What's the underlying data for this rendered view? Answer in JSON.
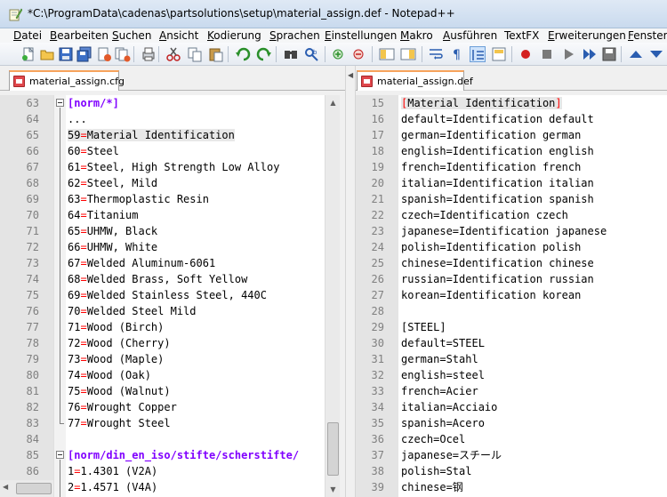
{
  "window": {
    "title": "*C:\\ProgramData\\cadenas\\partsolutions\\setup\\material_assign.def - Notepad++"
  },
  "menu": [
    {
      "label": "Datei",
      "u": "D",
      "rest": "atei"
    },
    {
      "label": "Bearbeiten",
      "u": "B",
      "rest": "earbeiten"
    },
    {
      "label": "Suchen",
      "u": "S",
      "rest": "uchen"
    },
    {
      "label": "Ansicht",
      "u": "A",
      "rest": "nsicht"
    },
    {
      "label": "Kodierung",
      "u": "K",
      "rest": "odierung"
    },
    {
      "label": "Sprachen",
      "u": "S",
      "rest": "prachen"
    },
    {
      "label": "Einstellungen",
      "u": "E",
      "rest": "instellungen"
    },
    {
      "label": "Makro",
      "u": "M",
      "rest": "akro"
    },
    {
      "label": "Ausführen",
      "u": "A",
      "rest": "usführen"
    },
    {
      "label": "TextFX",
      "u": "",
      "rest": "TextFX"
    },
    {
      "label": "Erweiterungen",
      "u": "E",
      "rest": "rweiterungen"
    },
    {
      "label": "Fenster",
      "u": "F",
      "rest": "enster"
    }
  ],
  "toolbar": [
    {
      "name": "new-file-icon"
    },
    {
      "name": "open-file-icon"
    },
    {
      "name": "save-icon"
    },
    {
      "name": "save-all-icon"
    },
    {
      "name": "close-icon"
    },
    {
      "name": "close-all-icon"
    },
    {
      "name": "print-icon"
    },
    {
      "name": "cut-icon"
    },
    {
      "name": "copy-icon"
    },
    {
      "name": "paste-icon"
    },
    {
      "name": "undo-icon"
    },
    {
      "name": "redo-icon"
    },
    {
      "name": "find-icon"
    },
    {
      "name": "replace-icon"
    },
    {
      "name": "zoom-in-icon"
    },
    {
      "name": "zoom-out-icon"
    },
    {
      "name": "sync-vertical-icon"
    },
    {
      "name": "sync-horizontal-icon"
    },
    {
      "name": "word-wrap-icon"
    },
    {
      "name": "show-all-chars-icon"
    },
    {
      "name": "indent-guide-icon"
    },
    {
      "name": "doc-map-icon"
    },
    {
      "name": "record-macro-icon"
    },
    {
      "name": "stop-macro-icon"
    },
    {
      "name": "play-macro-icon"
    },
    {
      "name": "run-macro-multiple-icon"
    },
    {
      "name": "save-macro-icon"
    },
    {
      "name": "upload-icon"
    },
    {
      "name": "download-icon"
    }
  ],
  "left": {
    "tab": "material_assign.cfg",
    "lines": [
      {
        "n": "63",
        "parts": [
          {
            "t": "[norm/*]",
            "c": "section"
          }
        ],
        "fold": "start"
      },
      {
        "n": "64",
        "parts": [
          {
            "t": "...",
            "c": "key"
          }
        ]
      },
      {
        "n": "65",
        "parts": [
          {
            "t": "59",
            "c": "key"
          },
          {
            "t": "=",
            "c": "eq"
          },
          {
            "t": "Material Identification",
            "c": "key"
          }
        ],
        "hl": true
      },
      {
        "n": "66",
        "parts": [
          {
            "t": "60",
            "c": "key"
          },
          {
            "t": "=",
            "c": "eq"
          },
          {
            "t": "Steel",
            "c": "key"
          }
        ]
      },
      {
        "n": "67",
        "parts": [
          {
            "t": "61",
            "c": "key"
          },
          {
            "t": "=",
            "c": "eq"
          },
          {
            "t": "Steel, High Strength Low Alloy",
            "c": "key"
          }
        ]
      },
      {
        "n": "68",
        "parts": [
          {
            "t": "62",
            "c": "key"
          },
          {
            "t": "=",
            "c": "eq"
          },
          {
            "t": "Steel, Mild",
            "c": "key"
          }
        ]
      },
      {
        "n": "69",
        "parts": [
          {
            "t": "63",
            "c": "key"
          },
          {
            "t": "=",
            "c": "eq"
          },
          {
            "t": "Thermoplastic Resin",
            "c": "key"
          }
        ]
      },
      {
        "n": "70",
        "parts": [
          {
            "t": "64",
            "c": "key"
          },
          {
            "t": "=",
            "c": "eq"
          },
          {
            "t": "Titanium",
            "c": "key"
          }
        ]
      },
      {
        "n": "71",
        "parts": [
          {
            "t": "65",
            "c": "key"
          },
          {
            "t": "=",
            "c": "eq"
          },
          {
            "t": "UHMW, Black",
            "c": "key"
          }
        ]
      },
      {
        "n": "72",
        "parts": [
          {
            "t": "66",
            "c": "key"
          },
          {
            "t": "=",
            "c": "eq"
          },
          {
            "t": "UHMW, White",
            "c": "key"
          }
        ]
      },
      {
        "n": "73",
        "parts": [
          {
            "t": "67",
            "c": "key"
          },
          {
            "t": "=",
            "c": "eq"
          },
          {
            "t": "Welded Aluminum-6061",
            "c": "key"
          }
        ]
      },
      {
        "n": "74",
        "parts": [
          {
            "t": "68",
            "c": "key"
          },
          {
            "t": "=",
            "c": "eq"
          },
          {
            "t": "Welded Brass, Soft Yellow",
            "c": "key"
          }
        ]
      },
      {
        "n": "75",
        "parts": [
          {
            "t": "69",
            "c": "key"
          },
          {
            "t": "=",
            "c": "eq"
          },
          {
            "t": "Welded Stainless Steel, 440C",
            "c": "key"
          }
        ]
      },
      {
        "n": "76",
        "parts": [
          {
            "t": "70",
            "c": "key"
          },
          {
            "t": "=",
            "c": "eq"
          },
          {
            "t": "Welded Steel Mild",
            "c": "key"
          }
        ]
      },
      {
        "n": "77",
        "parts": [
          {
            "t": "71",
            "c": "key"
          },
          {
            "t": "=",
            "c": "eq"
          },
          {
            "t": "Wood (Birch)",
            "c": "key"
          }
        ]
      },
      {
        "n": "78",
        "parts": [
          {
            "t": "72",
            "c": "key"
          },
          {
            "t": "=",
            "c": "eq"
          },
          {
            "t": "Wood (Cherry)",
            "c": "key"
          }
        ]
      },
      {
        "n": "79",
        "parts": [
          {
            "t": "73",
            "c": "key"
          },
          {
            "t": "=",
            "c": "eq"
          },
          {
            "t": "Wood (Maple)",
            "c": "key"
          }
        ]
      },
      {
        "n": "80",
        "parts": [
          {
            "t": "74",
            "c": "key"
          },
          {
            "t": "=",
            "c": "eq"
          },
          {
            "t": "Wood (Oak)",
            "c": "key"
          }
        ]
      },
      {
        "n": "81",
        "parts": [
          {
            "t": "75",
            "c": "key"
          },
          {
            "t": "=",
            "c": "eq"
          },
          {
            "t": "Wood (Walnut)",
            "c": "key"
          }
        ]
      },
      {
        "n": "82",
        "parts": [
          {
            "t": "76",
            "c": "key"
          },
          {
            "t": "=",
            "c": "eq"
          },
          {
            "t": "Wrought Copper",
            "c": "key"
          }
        ]
      },
      {
        "n": "83",
        "parts": [
          {
            "t": "77",
            "c": "key"
          },
          {
            "t": "=",
            "c": "eq"
          },
          {
            "t": "Wrought Steel",
            "c": "key"
          }
        ],
        "fold": "end"
      },
      {
        "n": "84",
        "parts": []
      },
      {
        "n": "85",
        "parts": [
          {
            "t": "[norm/din_en_iso/stifte/scherstifte/",
            "c": "section"
          }
        ],
        "fold": "start"
      },
      {
        "n": "86",
        "parts": [
          {
            "t": "1",
            "c": "key"
          },
          {
            "t": "=",
            "c": "eq"
          },
          {
            "t": "1.4301 (V2A)",
            "c": "key"
          }
        ]
      },
      {
        "n": "",
        "parts": [
          {
            "t": "2",
            "c": "key"
          },
          {
            "t": "=",
            "c": "eq"
          },
          {
            "t": "1.4571 (V4A)",
            "c": "key"
          }
        ]
      }
    ]
  },
  "right": {
    "tab": "material_assign.def",
    "lines": [
      {
        "n": "15",
        "parts": [
          {
            "t": "[",
            "c": "brace"
          },
          {
            "t": "Material Identification",
            "c": "key"
          },
          {
            "t": "]",
            "c": "brace"
          }
        ],
        "match": true
      },
      {
        "n": "16",
        "parts": [
          {
            "t": "default=Identification default",
            "c": "key"
          }
        ]
      },
      {
        "n": "17",
        "parts": [
          {
            "t": "german=Identification german",
            "c": "key"
          }
        ]
      },
      {
        "n": "18",
        "parts": [
          {
            "t": "english=Identification english",
            "c": "key"
          }
        ]
      },
      {
        "n": "19",
        "parts": [
          {
            "t": "french=Identification french",
            "c": "key"
          }
        ]
      },
      {
        "n": "20",
        "parts": [
          {
            "t": "italian=Identification italian",
            "c": "key"
          }
        ]
      },
      {
        "n": "21",
        "parts": [
          {
            "t": "spanish=Identification spanish",
            "c": "key"
          }
        ]
      },
      {
        "n": "22",
        "parts": [
          {
            "t": "czech=Identification czech",
            "c": "key"
          }
        ]
      },
      {
        "n": "23",
        "parts": [
          {
            "t": "japanese=Identification japanese",
            "c": "key"
          }
        ]
      },
      {
        "n": "24",
        "parts": [
          {
            "t": "polish=Identification polish",
            "c": "key"
          }
        ]
      },
      {
        "n": "25",
        "parts": [
          {
            "t": "chinese=Identification chinese",
            "c": "key"
          }
        ]
      },
      {
        "n": "26",
        "parts": [
          {
            "t": "russian=Identification russian",
            "c": "key"
          }
        ]
      },
      {
        "n": "27",
        "parts": [
          {
            "t": "korean=Identification korean",
            "c": "key"
          }
        ]
      },
      {
        "n": "28",
        "parts": []
      },
      {
        "n": "29",
        "parts": [
          {
            "t": "[STEEL]",
            "c": "key"
          }
        ]
      },
      {
        "n": "30",
        "parts": [
          {
            "t": "default=STEEL",
            "c": "key"
          }
        ]
      },
      {
        "n": "31",
        "parts": [
          {
            "t": "german=Stahl",
            "c": "key"
          }
        ]
      },
      {
        "n": "32",
        "parts": [
          {
            "t": "english=steel",
            "c": "key"
          }
        ]
      },
      {
        "n": "33",
        "parts": [
          {
            "t": "french=Acier",
            "c": "key"
          }
        ]
      },
      {
        "n": "34",
        "parts": [
          {
            "t": "italian=Acciaio",
            "c": "key"
          }
        ]
      },
      {
        "n": "35",
        "parts": [
          {
            "t": "spanish=Acero",
            "c": "key"
          }
        ]
      },
      {
        "n": "36",
        "parts": [
          {
            "t": "czech=Ocel",
            "c": "key"
          }
        ]
      },
      {
        "n": "37",
        "parts": [
          {
            "t": "japanese=スチール",
            "c": "key"
          }
        ]
      },
      {
        "n": "38",
        "parts": [
          {
            "t": "polish=Stal",
            "c": "key"
          }
        ]
      },
      {
        "n": "39",
        "parts": [
          {
            "t": "chinese=钢",
            "c": "key"
          }
        ]
      }
    ]
  }
}
